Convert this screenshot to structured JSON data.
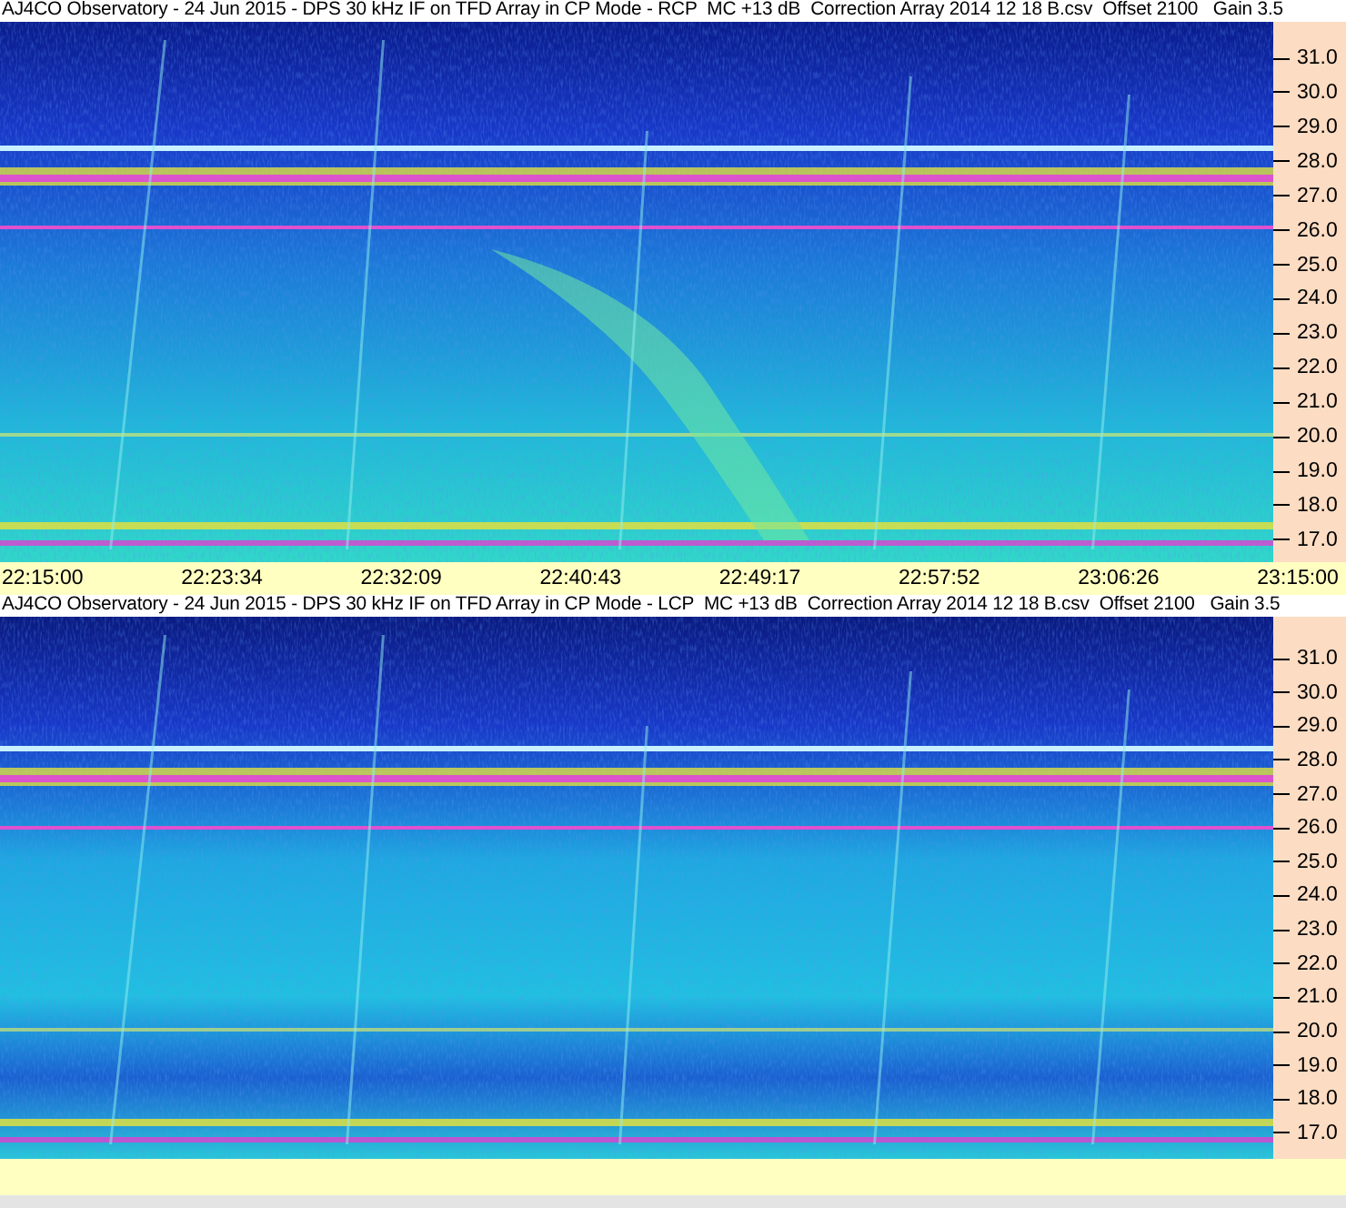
{
  "panels": [
    {
      "title": "AJ4CO Observatory - 24 Jun 2015 - DPS 30 kHz IF on TFD Array in CP Mode - RCP  MC +13 dB  Correction Array 2014 12 18 B.csv  Offset 2100   Gain 3.5",
      "y_axis_labels": [
        "31.0",
        "30.0",
        "29.0",
        "28.0",
        "27.0",
        "26.0",
        "25.0",
        "24.0",
        "23.0",
        "22.0",
        "21.0",
        "20.0",
        "19.0",
        "18.0",
        "17.0"
      ],
      "time_axis_labels": [
        "22:15:00",
        "22:23:34",
        "22:32:09",
        "22:40:43",
        "22:49:17",
        "22:57:52",
        "23:06:26",
        "23:15:00"
      ]
    },
    {
      "title": "AJ4CO Observatory - 24 Jun 2015 - DPS 30 kHz IF on TFD Array in CP Mode - LCP  MC +13 dB  Correction Array 2014 12 18 B.csv  Offset 2100   Gain 3.5",
      "y_axis_labels": [
        "31.0",
        "30.0",
        "29.0",
        "28.0",
        "27.0",
        "26.0",
        "25.0",
        "24.0",
        "23.0",
        "22.0",
        "21.0",
        "20.0",
        "19.0",
        "18.0",
        "17.0"
      ]
    }
  ]
}
